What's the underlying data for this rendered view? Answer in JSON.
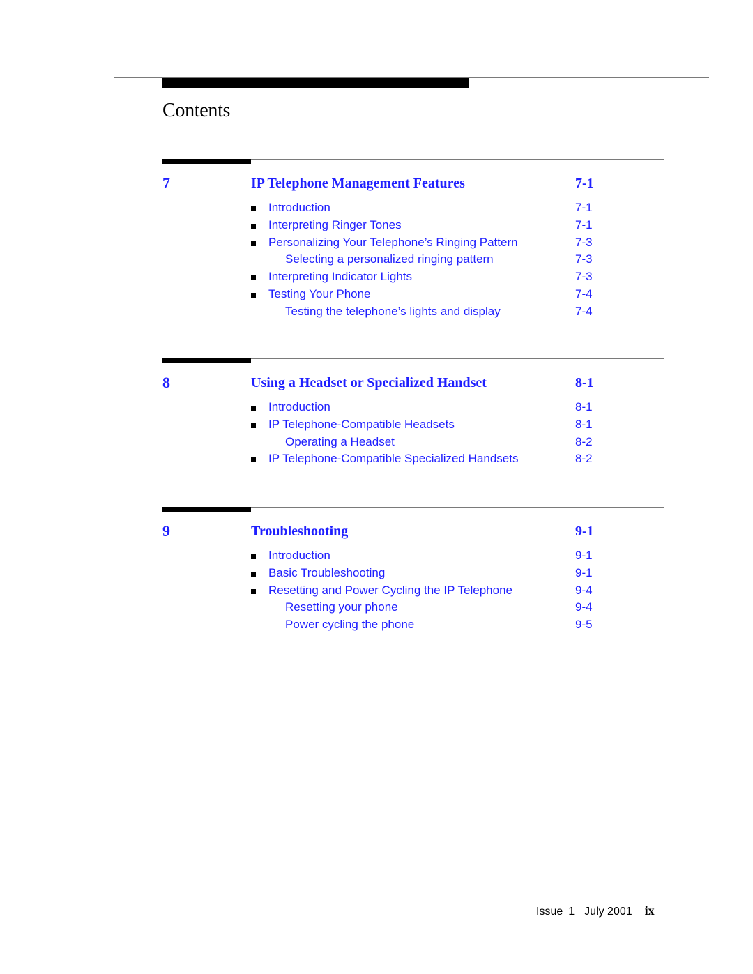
{
  "page": {
    "title": "Contents"
  },
  "chapters": [
    {
      "number": "7",
      "title": "IP Telephone Management Features",
      "page": "7-1",
      "entries": [
        {
          "label": "Introduction",
          "page": "7-1",
          "level": 1
        },
        {
          "label": "Interpreting Ringer Tones",
          "page": "7-1",
          "level": 1
        },
        {
          "label": "Personalizing Your Telephone’s Ringing Pattern",
          "page": "7-3",
          "level": 1
        },
        {
          "label": "Selecting a personalized ringing pattern",
          "page": "7-3",
          "level": 2
        },
        {
          "label": "Interpreting Indicator Lights",
          "page": "7-3",
          "level": 1
        },
        {
          "label": "Testing Your Phone",
          "page": "7-4",
          "level": 1
        },
        {
          "label": "Testing the telephone’s lights and display",
          "page": "7-4",
          "level": 2
        }
      ]
    },
    {
      "number": "8",
      "title": "Using a Headset or Specialized Handset",
      "page": "8-1",
      "entries": [
        {
          "label": "Introduction",
          "page": "8-1",
          "level": 1
        },
        {
          "label": "IP Telephone-Compatible Headsets",
          "page": "8-1",
          "level": 1
        },
        {
          "label": "Operating a Headset",
          "page": "8-2",
          "level": 2
        },
        {
          "label": "IP Telephone-Compatible Specialized Handsets",
          "page": "8-2",
          "level": 1
        }
      ]
    },
    {
      "number": "9",
      "title": "Troubleshooting",
      "page": "9-1",
      "entries": [
        {
          "label": "Introduction",
          "page": "9-1",
          "level": 1
        },
        {
          "label": "Basic Troubleshooting",
          "page": "9-1",
          "level": 1
        },
        {
          "label": "Resetting and Power Cycling the IP Telephone",
          "page": "9-4",
          "level": 1
        },
        {
          "label": "Resetting your phone",
          "page": "9-4",
          "level": 2
        },
        {
          "label": "Power cycling the phone",
          "page": "9-5",
          "level": 2
        }
      ]
    }
  ],
  "footer": {
    "issue_label": "Issue",
    "issue_number": "1",
    "date": "July 2001",
    "folio": "ix"
  },
  "colors": {
    "link": "#1f1fff",
    "text": "#000000"
  }
}
